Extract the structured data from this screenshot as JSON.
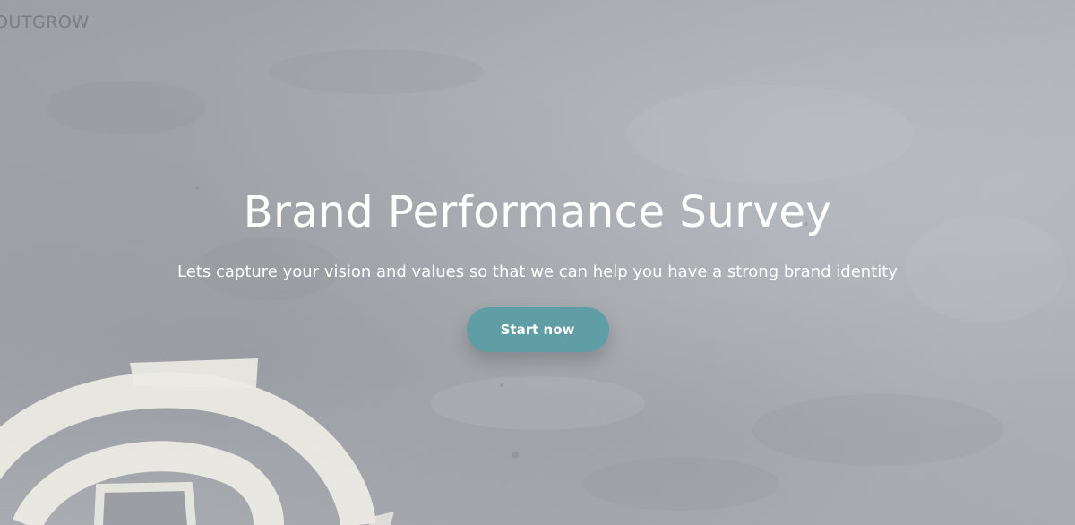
{
  "brand": {
    "logo_text": "OUTGROW"
  },
  "hero": {
    "title": "Brand Performance Survey",
    "subtitle": "Lets capture your vision and values so that we can help you have a strong brand identity",
    "cta_label": "Start now"
  },
  "colors": {
    "cta_background": "#5f9ea5",
    "text": "#ffffff",
    "background": "#a9acb1"
  },
  "icons": {
    "background_art": "tape-at-sign-graphic"
  }
}
